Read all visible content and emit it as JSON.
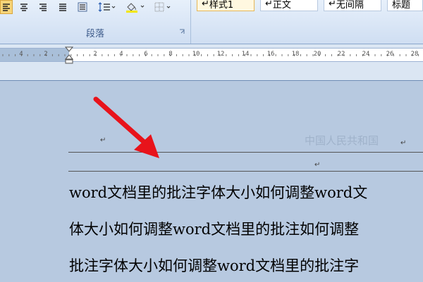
{
  "ribbon": {
    "paragraph_group_label": "段落",
    "styles": [
      "样式1",
      "正文",
      "无间隔",
      "标题"
    ],
    "style_tile_prefix": "↵"
  },
  "ruler": {
    "numbers": [
      "4",
      "2",
      "2",
      "4",
      "6",
      "8",
      "10",
      "12",
      "14",
      "16",
      "18",
      "20",
      "22",
      "24",
      "26",
      "28"
    ]
  },
  "document": {
    "header_mark": "↵",
    "watermark": "中国人民共和国",
    "watermark_mark": "↵",
    "line_mark": "↵",
    "lines": [
      "word文档里的批注字体大小如何调整word文",
      "体大小如何调整word文档里的批注如何调整",
      "批注字体大小如何调整word文档里的批注字"
    ]
  },
  "colors": {
    "annotation_arrow": "#e8131b",
    "accent_highlight": "#f7d57a"
  }
}
